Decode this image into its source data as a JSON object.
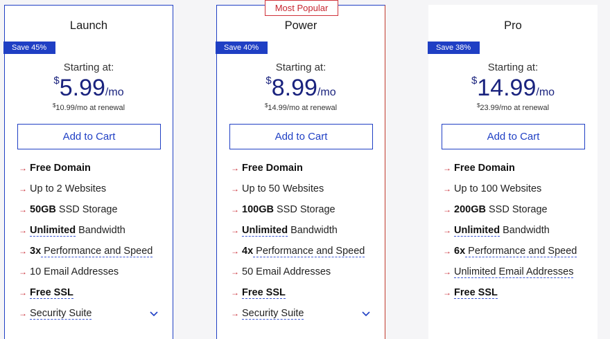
{
  "plans": [
    {
      "name": "Launch",
      "badge": "Save 45%",
      "starting": "Starting at:",
      "currency": "$",
      "price": "5.99",
      "per": "/mo",
      "renewal_currency": "$",
      "renewal_text": "10.99/mo at renewal",
      "cta": "Add to Cart",
      "features": [
        {
          "bold": "Free Domain",
          "rest": ""
        },
        {
          "bold": "",
          "rest": "Up to 2 Websites"
        },
        {
          "bold": "50GB",
          "rest": " SSD Storage"
        },
        {
          "bold": "Unlimited",
          "rest": " Bandwidth"
        },
        {
          "bold": "3x",
          "rest": " Performance and Speed"
        },
        {
          "bold": "",
          "rest": "10 Email Addresses"
        },
        {
          "bold": "Free SSL",
          "rest": ""
        },
        {
          "bold": "",
          "rest": "Security Suite"
        }
      ]
    },
    {
      "name": "Power",
      "popular": "Most Popular",
      "badge": "Save 40%",
      "starting": "Starting at:",
      "currency": "$",
      "price": "8.99",
      "per": "/mo",
      "renewal_currency": "$",
      "renewal_text": "14.99/mo at renewal",
      "cta": "Add to Cart",
      "features": [
        {
          "bold": "Free Domain",
          "rest": ""
        },
        {
          "bold": "",
          "rest": "Up to 50 Websites"
        },
        {
          "bold": "100GB",
          "rest": " SSD Storage"
        },
        {
          "bold": "Unlimited",
          "rest": " Bandwidth"
        },
        {
          "bold": "4x",
          "rest": " Performance and Speed"
        },
        {
          "bold": "",
          "rest": "50 Email Addresses"
        },
        {
          "bold": "Free SSL",
          "rest": ""
        },
        {
          "bold": "",
          "rest": "Security Suite"
        }
      ]
    },
    {
      "name": "Pro",
      "badge": "Save 38%",
      "starting": "Starting at:",
      "currency": "$",
      "price": "14.99",
      "per": "/mo",
      "renewal_currency": "$",
      "renewal_text": "23.99/mo at renewal",
      "cta": "Add to Cart",
      "features": [
        {
          "bold": "Free Domain",
          "rest": ""
        },
        {
          "bold": "",
          "rest": "Up to 100 Websites"
        },
        {
          "bold": "200GB",
          "rest": " SSD Storage"
        },
        {
          "bold": "Unlimited",
          "rest": " Bandwidth"
        },
        {
          "bold": "6x",
          "rest": " Performance and Speed"
        },
        {
          "bold": "",
          "rest": "Unlimited Email Addresses"
        },
        {
          "bold": "Free SSL",
          "rest": ""
        }
      ]
    }
  ],
  "colors": {
    "brand_blue": "#1f3fc4",
    "price_navy": "#1a237e",
    "accent_red": "#c7252f"
  },
  "icons": {
    "feature_bullet": "arrow-right-icon",
    "expand": "chevron-down-icon"
  }
}
